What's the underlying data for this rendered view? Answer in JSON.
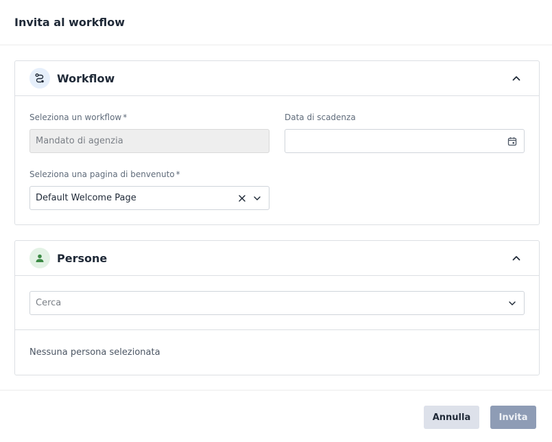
{
  "modal": {
    "title": "Invita al workflow"
  },
  "workflow_section": {
    "title": "Workflow",
    "icon": "workflow-route-icon",
    "workflow_field": {
      "label": "Seleziona un workflow",
      "required_mark": "*",
      "value": "Mandato di agenzia"
    },
    "due_date_field": {
      "label": "Data di scadenza",
      "value": ""
    },
    "welcome_page_field": {
      "label": "Seleziona una pagina di benvenuto",
      "required_mark": "*",
      "value": "Default Welcome Page"
    }
  },
  "people_section": {
    "title": "Persone",
    "icon": "person-icon",
    "search": {
      "placeholder": "Cerca"
    },
    "empty_message": "Nessuna persona selezionata"
  },
  "footer": {
    "cancel_label": "Annulla",
    "invite_label": "Invita"
  },
  "colors": {
    "workflow_icon_bg": "#e6effb",
    "person_icon": "#3c8a45",
    "invite_button_disabled": "#8e9cb5"
  }
}
